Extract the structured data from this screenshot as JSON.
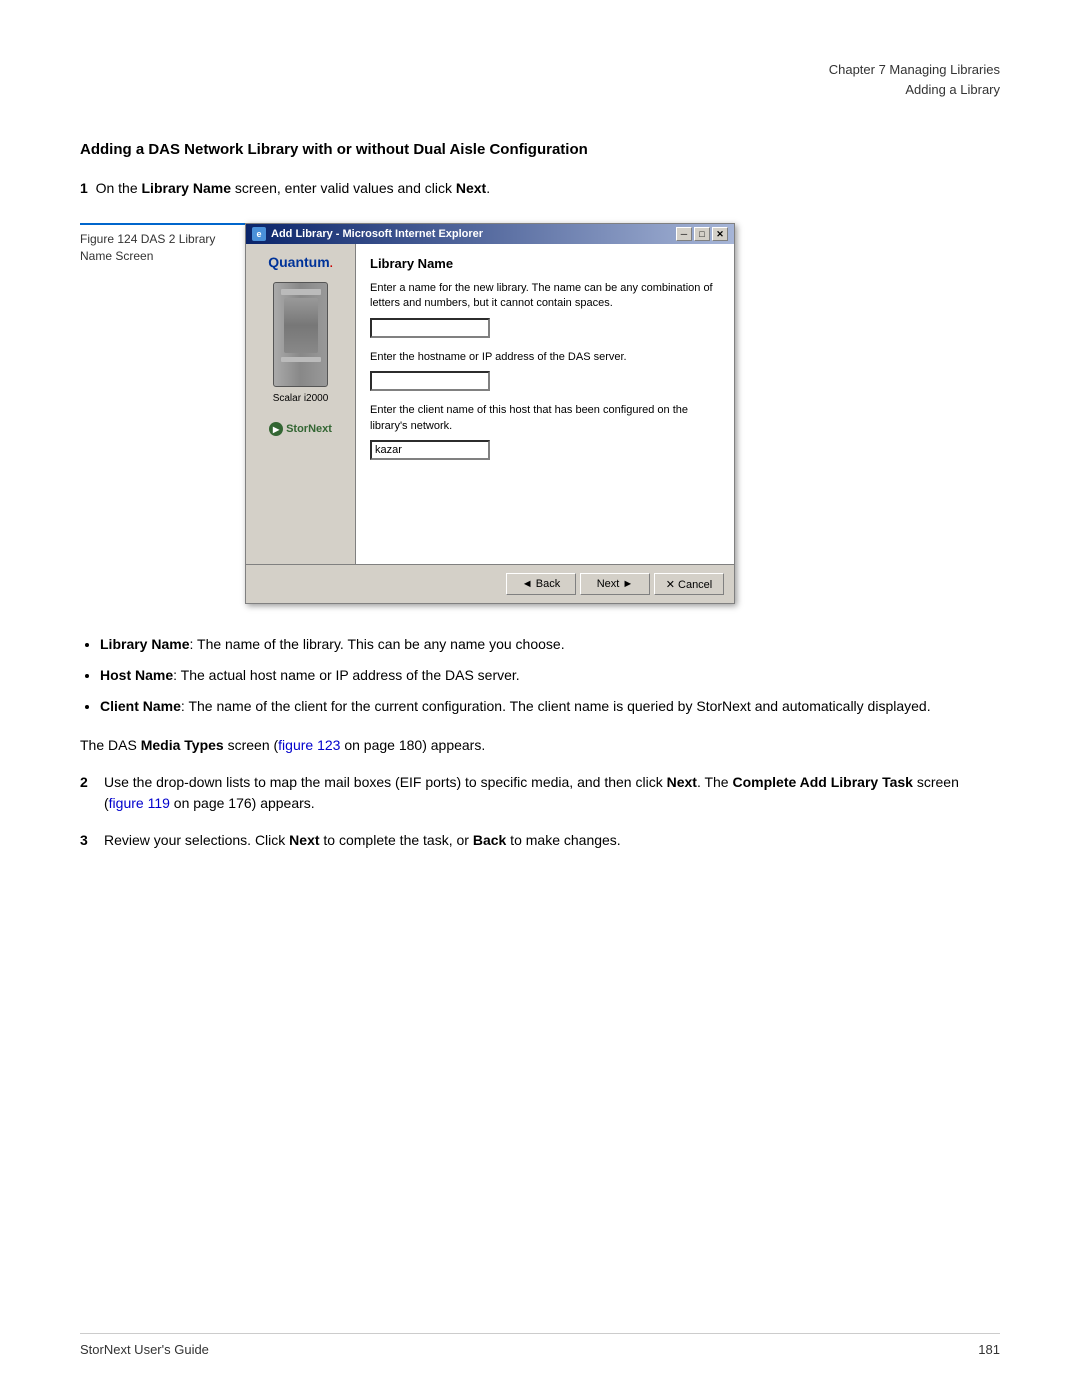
{
  "header": {
    "chapter": "Chapter 7  Managing Libraries",
    "subsection": "Adding a Library"
  },
  "section": {
    "title": "Adding a DAS Network Library with or without Dual Aisle Configuration",
    "step1_intro": "On the ",
    "step1_bold": "Library Name",
    "step1_rest": " screen, enter valid values and click ",
    "step1_next": "Next",
    "step1_period": "."
  },
  "figure": {
    "label": "Figure 124  DAS 2 Library Name Screen"
  },
  "dialog": {
    "title": "Add Library - Microsoft Internet Explorer",
    "controls": {
      "minimize": "─",
      "maximize": "□",
      "close": "✕"
    },
    "sidebar": {
      "logo": "Quantum.",
      "device_label": "Scalar i2000",
      "stornext_label": "StorNext"
    },
    "content": {
      "section_title": "Library Name",
      "field1_desc": "Enter a name for the new library. The name can be any combination of letters and numbers, but it cannot contain spaces.",
      "field1_value": "",
      "field2_desc": "Enter the hostname or IP address of the DAS server.",
      "field2_value": "",
      "field3_desc": "Enter the client name of this host that has been configured on the library's network.",
      "field3_value": "kazar"
    },
    "footer": {
      "back_label": "◄  Back",
      "next_label": "Next  ►",
      "cancel_label": "✕  Cancel"
    }
  },
  "bullets": [
    {
      "bold": "Library Name",
      "text": ": The name of the library. This can be any name you choose."
    },
    {
      "bold": "Host Name",
      "text": ": The actual host name or IP address of the DAS server."
    },
    {
      "bold": "Client Name",
      "text": ": The name of the client for the current configuration. The client name is queried by StorNext and automatically displayed."
    }
  ],
  "media_types_text": "The DAS ",
  "media_types_bold": "Media Types",
  "media_types_rest": " screen (",
  "media_types_link": "figure 123",
  "media_types_page": " on page 180) appears.",
  "step2_num": "2",
  "step2_text": "Use the drop-down lists to map the mail boxes (EIF ports) to specific media, and then click ",
  "step2_bold1": "Next",
  "step2_text2": ". The ",
  "step2_bold2": "Complete Add Library Task",
  "step2_text3": " screen (",
  "step2_link": "figure 119",
  "step2_page": " on page 176) appears.",
  "step3_num": "3",
  "step3_text": "Review your selections. Click ",
  "step3_bold1": "Next",
  "step3_text2": " to complete the task, or ",
  "step3_bold2": "Back",
  "step3_text3": " to make changes.",
  "footer": {
    "left": "StorNext User's Guide",
    "page": "181"
  }
}
